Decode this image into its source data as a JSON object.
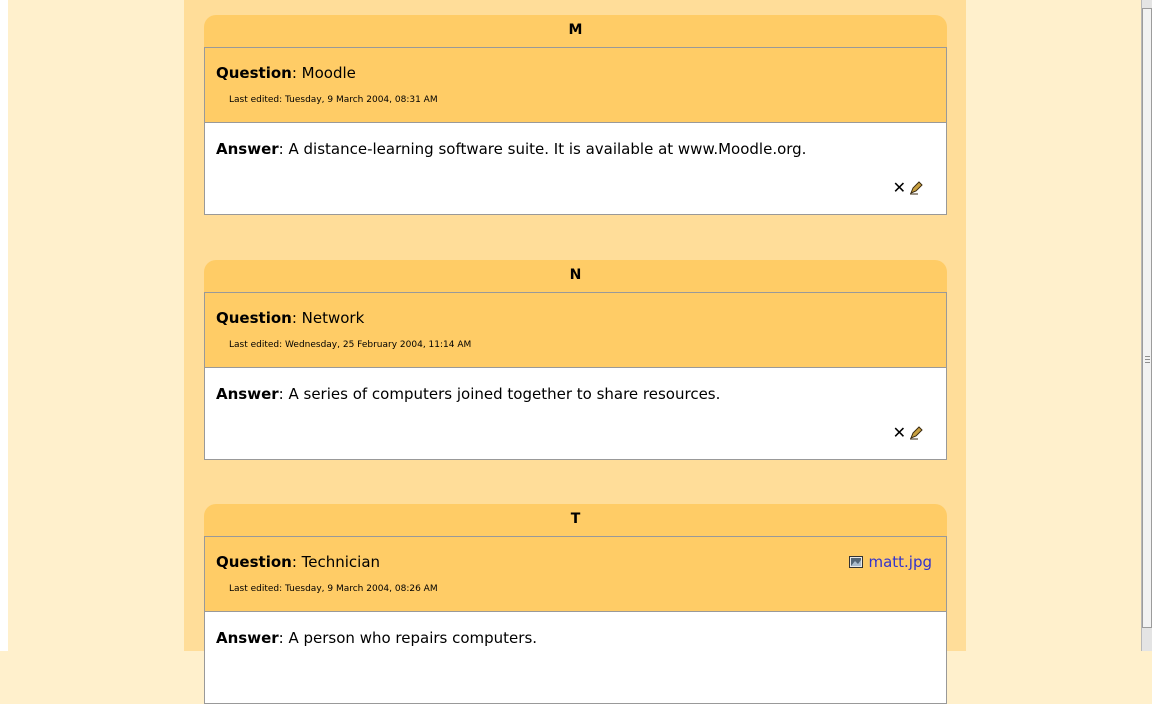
{
  "entries": [
    {
      "letter": "M",
      "question_label": "Question",
      "question": "Moodle",
      "last_edited": "Last edited: Tuesday, 9 March 2004, 08:31 AM",
      "answer_label": "Answer",
      "answer": "A distance-learning software suite. It is available at www.Moodle.org."
    },
    {
      "letter": "N",
      "question_label": "Question",
      "question": "Network",
      "last_edited": "Last edited: Wednesday, 25 February 2004, 11:14 AM",
      "answer_label": "Answer",
      "answer": "A series of computers joined together to share resources."
    },
    {
      "letter": "T",
      "question_label": "Question",
      "question": "Technician",
      "last_edited": "Last edited: Tuesday, 9 March 2004, 08:26 AM",
      "answer_label": "Answer",
      "answer": "A person who repairs computers.",
      "attachment": "matt.jpg"
    }
  ],
  "icons": {
    "delete": "close-icon",
    "edit": "edit-icon",
    "attachment": "image-icon"
  },
  "colors": {
    "page_background": "#fff0cc",
    "column_background": "#ffdd99",
    "header_background": "#ffcc66",
    "link": "#3333cc"
  }
}
